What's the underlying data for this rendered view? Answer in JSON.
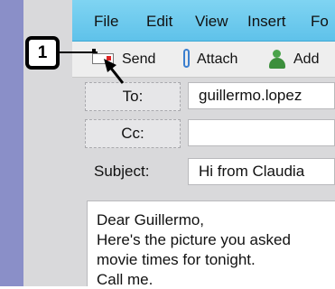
{
  "menu": {
    "file": "File",
    "edit": "Edit",
    "view": "View",
    "insert": "Insert",
    "format_partial": "Fo"
  },
  "toolbar": {
    "send_label": "Send",
    "attach_label": "Attach",
    "add_partial": "Add"
  },
  "fields": {
    "to_label": "To:",
    "to_value": "guillermo.lopez",
    "cc_label": "Cc:",
    "cc_value": "",
    "subject_label": "Subject:",
    "subject_value": "Hi from Claudia"
  },
  "message_body": {
    "lines": [
      "Dear Guillermo,",
      "Here's the picture you asked",
      "movie times for tonight.",
      "Call me."
    ]
  },
  "callout": {
    "number": "1"
  },
  "colors": {
    "menubar": "#6ccbef",
    "sidebar": "#8a8fc8",
    "frame": "#d9d9db",
    "send_flap": "#d22222"
  }
}
